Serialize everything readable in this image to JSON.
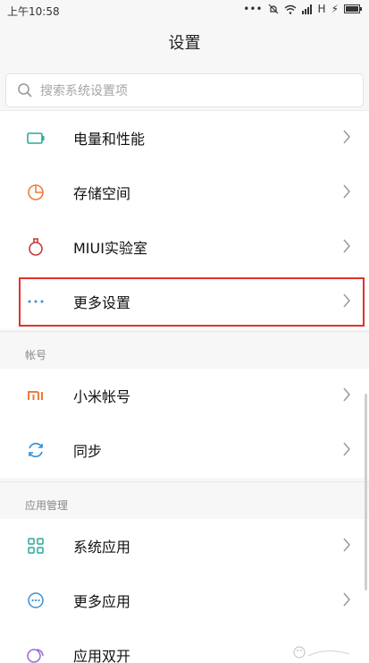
{
  "status": {
    "time": "上午10:58",
    "network_label": "H"
  },
  "header": {
    "title": "设置"
  },
  "search": {
    "placeholder": "搜索系统设置项"
  },
  "top_group": {
    "items": [
      {
        "label": "电量和性能",
        "icon": "battery-icon"
      },
      {
        "label": "存储空间",
        "icon": "storage-pie-icon"
      },
      {
        "label": "MIUI实验室",
        "icon": "lab-flask-icon"
      },
      {
        "label": "更多设置",
        "icon": "more-dots-icon"
      }
    ]
  },
  "account_section": {
    "header": "帐号",
    "items": [
      {
        "label": "小米帐号",
        "icon": "mi-logo-icon"
      },
      {
        "label": "同步",
        "icon": "sync-icon"
      }
    ]
  },
  "apps_section": {
    "header": "应用管理",
    "items": [
      {
        "label": "系统应用",
        "icon": "grid-apps-icon"
      },
      {
        "label": "更多应用",
        "icon": "more-apps-icon"
      },
      {
        "label": "应用双开",
        "icon": "dual-apps-icon"
      }
    ]
  },
  "colors": {
    "accent_teal": "#2aaa9a",
    "accent_orange": "#ef7b3a",
    "accent_red": "#c63a3a",
    "accent_blue": "#3a8fd9",
    "highlight_red": "#e0312b"
  }
}
